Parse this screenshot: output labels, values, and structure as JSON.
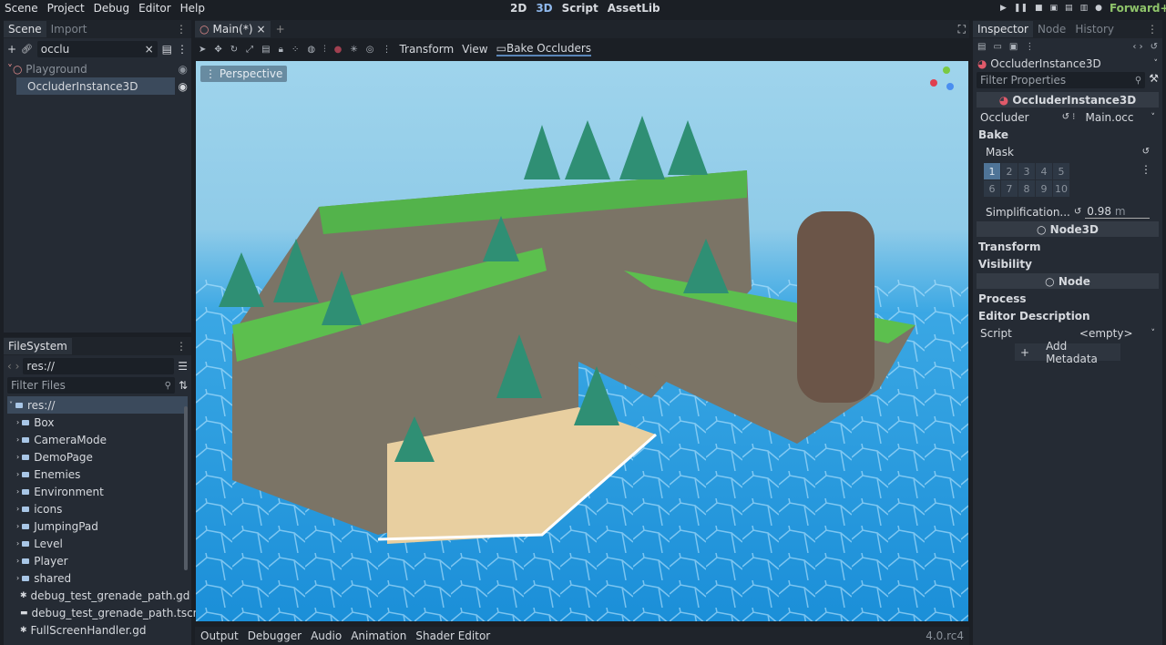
{
  "menu": [
    "Scene",
    "Project",
    "Debug",
    "Editor",
    "Help"
  ],
  "main_screens": [
    "2D",
    "3D",
    "Script",
    "AssetLib"
  ],
  "renderer": "Forward+",
  "scene_dock": {
    "tabs": [
      "Scene",
      "Import"
    ],
    "filter": "occlu",
    "tree": [
      {
        "label": "Playground"
      },
      {
        "label": "OccluderInstance3D"
      }
    ]
  },
  "filesystem": {
    "title": "FileSystem",
    "path": "res://",
    "filter_placeholder": "Filter Files",
    "root": "res://",
    "folders": [
      "Box",
      "CameraMode",
      "DemoPage",
      "Enemies",
      "Environment",
      "icons",
      "JumpingPad",
      "Level",
      "Player",
      "shared"
    ],
    "files": [
      "debug_test_grenade_path.gd",
      "debug_test_grenade_path.tscn",
      "FullScreenHandler.gd"
    ]
  },
  "editor": {
    "tab": "Main(*)",
    "menus": [
      "Transform",
      "View"
    ],
    "bake_button": "Bake Occluders",
    "viewport_label": "Perspective"
  },
  "bottom": {
    "tabs": [
      "Output",
      "Debugger",
      "Audio",
      "Animation",
      "Shader Editor"
    ],
    "version": "4.0.rc4"
  },
  "inspector": {
    "tabs": [
      "Inspector",
      "Node",
      "History"
    ],
    "object": "OccluderInstance3D",
    "filter_placeholder": "Filter Properties",
    "section_main": "OccluderInstance3D",
    "occluder_label": "Occluder",
    "occluder_value": "Main.occ",
    "bake": "Bake",
    "mask_label": "Mask",
    "mask_layers": [
      "1",
      "2",
      "3",
      "4",
      "5",
      "6",
      "7",
      "8",
      "9",
      "10"
    ],
    "mask_active": [
      1
    ],
    "simplification_label": "Simplification...",
    "simplification_value": "0.98",
    "simplification_unit": "m",
    "section_node3d": "Node3D",
    "transform": "Transform",
    "visibility": "Visibility",
    "section_node": "Node",
    "process": "Process",
    "editor_description": "Editor Description",
    "script_label": "Script",
    "script_value": "<empty>",
    "add_metadata": "Add Metadata"
  }
}
